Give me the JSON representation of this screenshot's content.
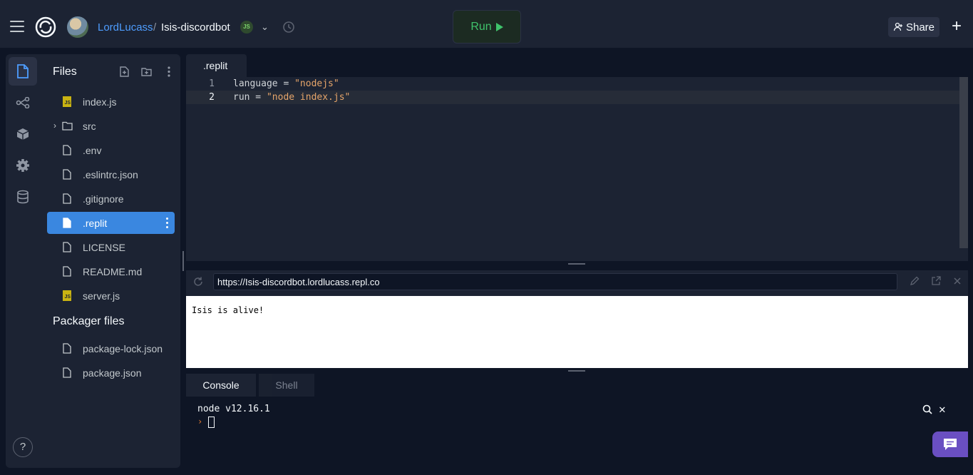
{
  "header": {
    "user": "LordLucass",
    "separator": "/",
    "repl_name": "Isis-discordbot",
    "language_badge": "JS",
    "run_label": "Run",
    "share_label": "Share",
    "plus_label": "+"
  },
  "sidebar": {
    "icons": [
      "files-icon",
      "version-control-icon",
      "packages-icon",
      "settings-icon",
      "database-icon"
    ],
    "help_label": "?"
  },
  "files": {
    "title": "Files",
    "items": [
      {
        "label": "index.js",
        "type": "js"
      },
      {
        "label": "src",
        "type": "folder"
      },
      {
        "label": ".env",
        "type": "file"
      },
      {
        "label": ".eslintrc.json",
        "type": "file"
      },
      {
        "label": ".gitignore",
        "type": "file"
      },
      {
        "label": ".replit",
        "type": "file",
        "selected": true
      },
      {
        "label": "LICENSE",
        "type": "file"
      },
      {
        "label": "README.md",
        "type": "file"
      },
      {
        "label": "server.js",
        "type": "js"
      }
    ],
    "packager_title": "Packager files",
    "packager_items": [
      {
        "label": "package-lock.json"
      },
      {
        "label": "package.json"
      }
    ]
  },
  "editor": {
    "tab": ".replit",
    "lines": [
      {
        "n": "1",
        "key": "language = ",
        "value": "\"nodejs\""
      },
      {
        "n": "2",
        "key": "run = ",
        "value": "\"node index.js\""
      }
    ]
  },
  "webview": {
    "url": "https://Isis-discordbot.lordlucass.repl.co",
    "body_text": "Isis is alive!"
  },
  "console": {
    "tabs": [
      "Console",
      "Shell"
    ],
    "output": "node v12.16.1",
    "prompt": "›"
  },
  "colors": {
    "accent_blue": "#3a87e0",
    "run_green": "#3fc36b",
    "background": "#0e1525",
    "panel": "#1c2333"
  }
}
